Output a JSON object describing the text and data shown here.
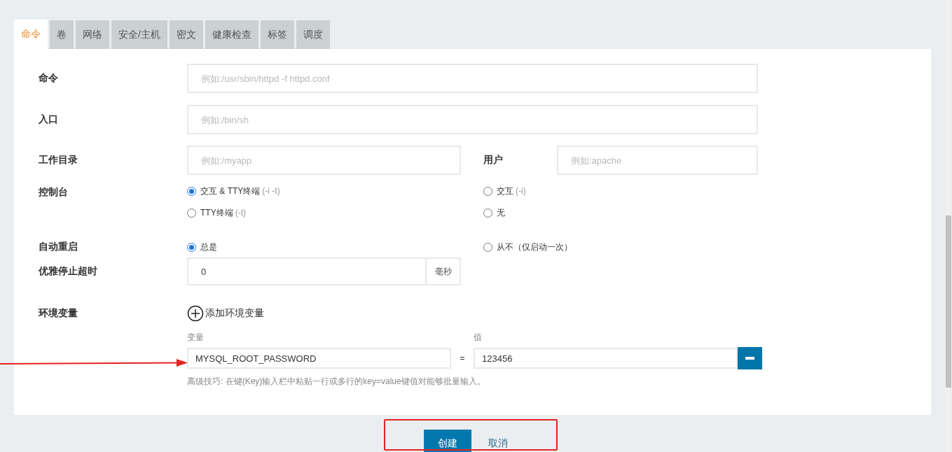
{
  "tabs": [
    {
      "label": "命令",
      "selected": true
    },
    {
      "label": "卷",
      "selected": false
    },
    {
      "label": "网络",
      "selected": false
    },
    {
      "label": "安全/主机",
      "selected": false
    },
    {
      "label": "密文",
      "selected": false
    },
    {
      "label": "健康检查",
      "selected": false
    },
    {
      "label": "标签",
      "selected": false
    },
    {
      "label": "调度",
      "selected": false
    }
  ],
  "command": {
    "label": "命令",
    "placeholder": "例如:/usr/sbin/httpd -f httpd.conf"
  },
  "entrypoint": {
    "label": "入口",
    "placeholder": "例如:/bin/sh"
  },
  "workdir": {
    "label": "工作目录",
    "placeholder": "例如:/myapp"
  },
  "user": {
    "label": "用户",
    "placeholder": "例如:apache"
  },
  "console": {
    "label": "控制台",
    "options": [
      {
        "label": "交互 & TTY终端",
        "hint": "(-i -t)",
        "selected": true
      },
      {
        "label": "交互",
        "hint": "(-i)",
        "selected": false
      },
      {
        "label": "TTY终端",
        "hint": "(-t)",
        "selected": false
      },
      {
        "label": "无",
        "selected": false
      }
    ]
  },
  "restart": {
    "label": "自动重启",
    "options": [
      {
        "label": "总是",
        "selected": true
      },
      {
        "label": "从不（仅启动一次）",
        "selected": false
      }
    ]
  },
  "stop_timeout": {
    "label": "优雅停止超时",
    "value": "0",
    "unit": "毫秒"
  },
  "env": {
    "label": "环境变量",
    "add_label": "添加环境变量",
    "key_header": "变量",
    "value_header": "值",
    "separator": "=",
    "vars": [
      {
        "key": "MYSQL_ROOT_PASSWORD",
        "value": "123456"
      }
    ],
    "hint": "高级技巧: 在键(Key)输入栏中粘贴一行或多行的key=value键值对能够批量输入。"
  },
  "buttons": [
    {
      "label": "创建",
      "kind": "primary"
    },
    {
      "label": "取消",
      "kind": "link"
    }
  ]
}
